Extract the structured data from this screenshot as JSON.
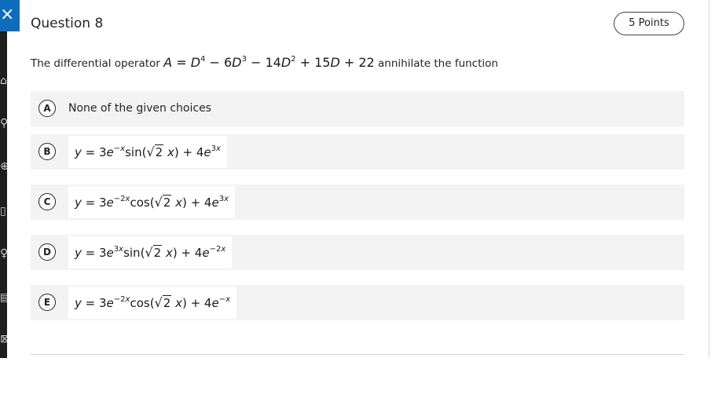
{
  "question": {
    "title": "Question 8",
    "points": "5 Points",
    "prompt_prefix": "The differential operator",
    "prompt_suffix": "annihilate the function"
  },
  "choices": [
    {
      "letter": "A",
      "text": "None of the given choices"
    },
    {
      "letter": "B"
    },
    {
      "letter": "C"
    },
    {
      "letter": "D"
    },
    {
      "letter": "E"
    }
  ],
  "icons": {
    "close": "×"
  }
}
